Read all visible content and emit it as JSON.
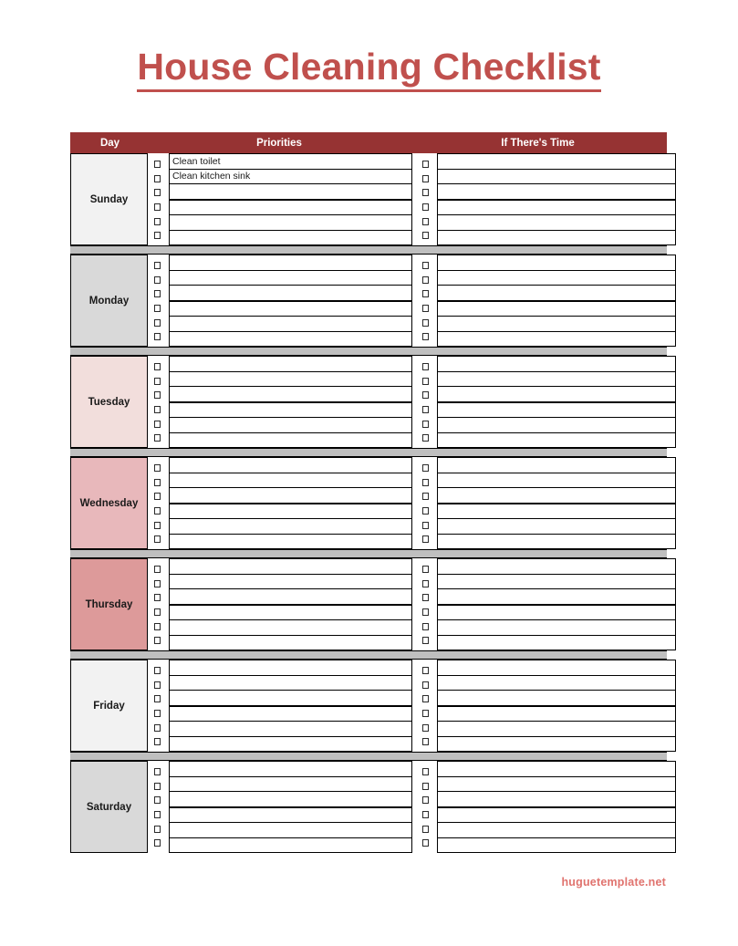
{
  "document": {
    "title": "House Cleaning Checklist",
    "title_color": "#c0504d",
    "header_bar_color": "#963333",
    "separator_color": "#bfbfbf",
    "footer_text": "huguetemplate.net",
    "footer_color": "#e0736e"
  },
  "table": {
    "columns": [
      {
        "key": "day",
        "label": "Day"
      },
      {
        "key": "prio",
        "label": "Priorities"
      },
      {
        "key": "time",
        "label": "If There's Time"
      }
    ],
    "rows_per_day": 6,
    "thick_rule_after_row": 3,
    "days": [
      {
        "name": "Sunday",
        "bg": "#f2f2f2",
        "priorities": [
          "Clean toilet",
          "Clean kitchen sink",
          "",
          "",
          "",
          ""
        ],
        "if_theres_time": [
          "",
          "",
          "",
          "",
          "",
          ""
        ],
        "priority_checks": [
          false,
          false,
          false,
          false,
          false,
          false
        ],
        "time_checks": [
          false,
          false,
          false,
          false,
          false,
          false
        ]
      },
      {
        "name": "Monday",
        "bg": "#d9d9d9",
        "priorities": [
          "",
          "",
          "",
          "",
          "",
          ""
        ],
        "if_theres_time": [
          "",
          "",
          "",
          "",
          "",
          ""
        ],
        "priority_checks": [
          false,
          false,
          false,
          false,
          false,
          false
        ],
        "time_checks": [
          false,
          false,
          false,
          false,
          false,
          false
        ]
      },
      {
        "name": "Tuesday",
        "bg": "#f2dedc",
        "priorities": [
          "",
          "",
          "",
          "",
          "",
          ""
        ],
        "if_theres_time": [
          "",
          "",
          "",
          "",
          "",
          ""
        ],
        "priority_checks": [
          false,
          false,
          false,
          false,
          false,
          false
        ],
        "time_checks": [
          false,
          false,
          false,
          false,
          false,
          false
        ]
      },
      {
        "name": "Wednesday",
        "bg": "#e8b8bb",
        "priorities": [
          "",
          "",
          "",
          "",
          "",
          ""
        ],
        "if_theres_time": [
          "",
          "",
          "",
          "",
          "",
          ""
        ],
        "priority_checks": [
          false,
          false,
          false,
          false,
          false,
          false
        ],
        "time_checks": [
          false,
          false,
          false,
          false,
          false,
          false
        ]
      },
      {
        "name": "Thursday",
        "bg": "#dd9a9a",
        "priorities": [
          "",
          "",
          "",
          "",
          "",
          ""
        ],
        "if_theres_time": [
          "",
          "",
          "",
          "",
          "",
          ""
        ],
        "priority_checks": [
          false,
          false,
          false,
          false,
          false,
          false
        ],
        "time_checks": [
          false,
          false,
          false,
          false,
          false,
          false
        ]
      },
      {
        "name": "Friday",
        "bg": "#f2f2f2",
        "priorities": [
          "",
          "",
          "",
          "",
          "",
          ""
        ],
        "if_theres_time": [
          "",
          "",
          "",
          "",
          "",
          ""
        ],
        "priority_checks": [
          false,
          false,
          false,
          false,
          false,
          false
        ],
        "time_checks": [
          false,
          false,
          false,
          false,
          false,
          false
        ]
      },
      {
        "name": "Saturday",
        "bg": "#d9d9d9",
        "priorities": [
          "",
          "",
          "",
          "",
          "",
          ""
        ],
        "if_theres_time": [
          "",
          "",
          "",
          "",
          "",
          ""
        ],
        "priority_checks": [
          false,
          false,
          false,
          false,
          false,
          false
        ],
        "time_checks": [
          false,
          false,
          false,
          false,
          false,
          false
        ]
      }
    ]
  }
}
